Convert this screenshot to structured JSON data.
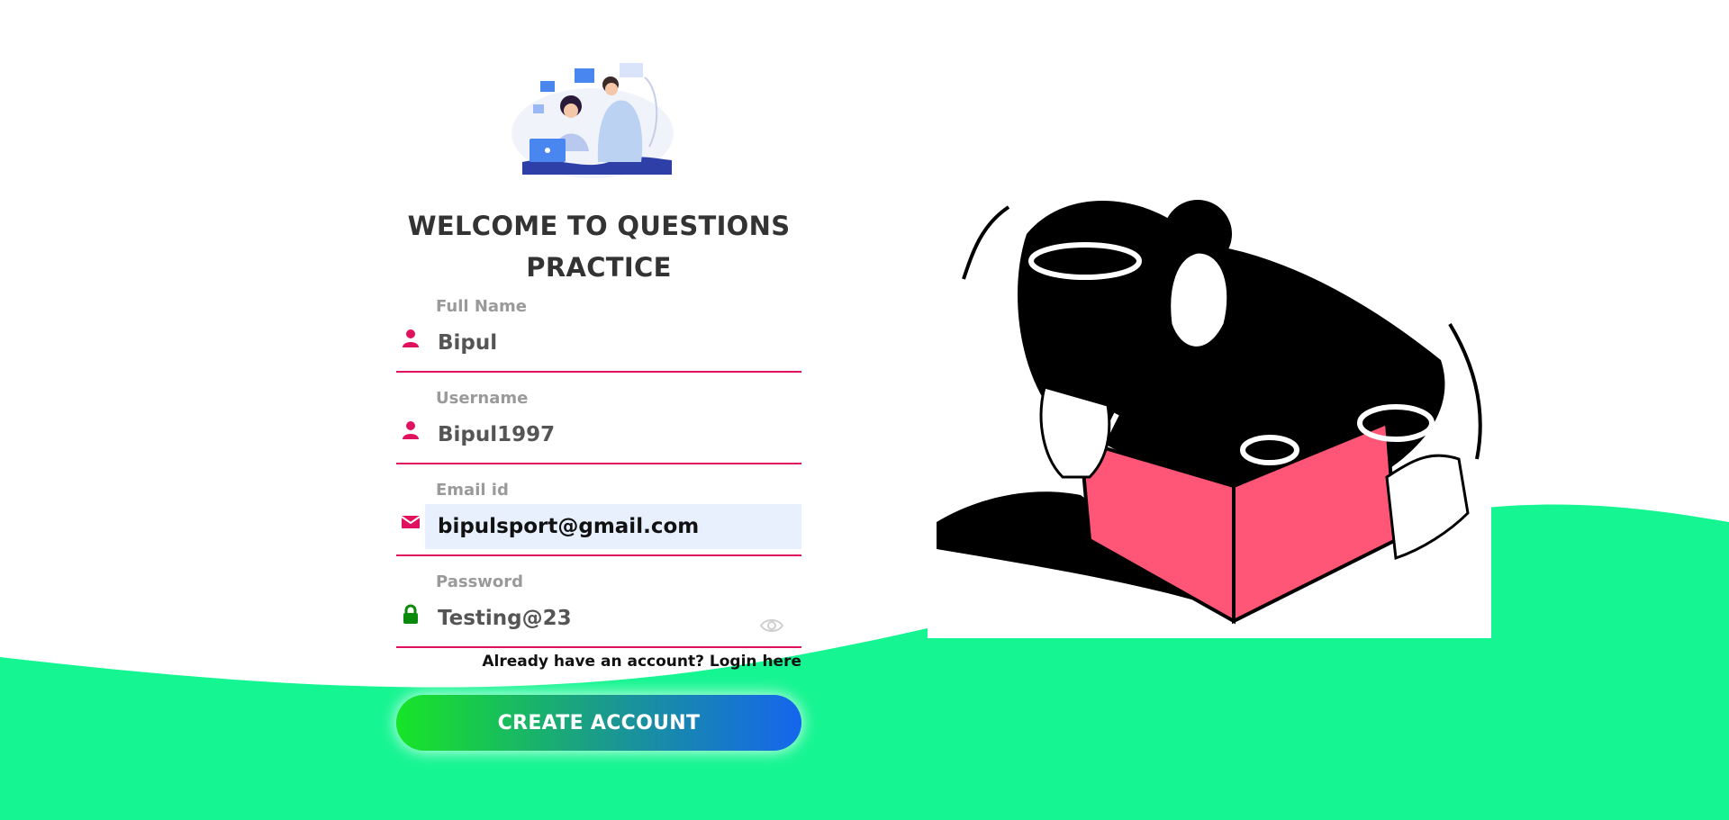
{
  "page": {
    "title": "WELCOME TO QUESTIONS PRACTICE"
  },
  "form": {
    "full_name": {
      "label": "Full Name",
      "value": "Bipul",
      "icon": "user-icon"
    },
    "username": {
      "label": "Username",
      "value": "Bipul1997",
      "icon": "user-icon"
    },
    "email": {
      "label": "Email id",
      "value": "bipulsport@gmail.com",
      "icon": "mail-icon"
    },
    "password": {
      "label": "Password",
      "value": "Testing@23",
      "icon": "lock-icon"
    },
    "login_link": "Already have an account? Login here",
    "submit_label": "CREATE ACCOUNT"
  },
  "colors": {
    "accent": "#e0115f",
    "wave": "#15f591",
    "lock": "#0a8a0a",
    "button_start": "#17e527",
    "button_end": "#1565ee",
    "art_pink": "#ff5577"
  }
}
